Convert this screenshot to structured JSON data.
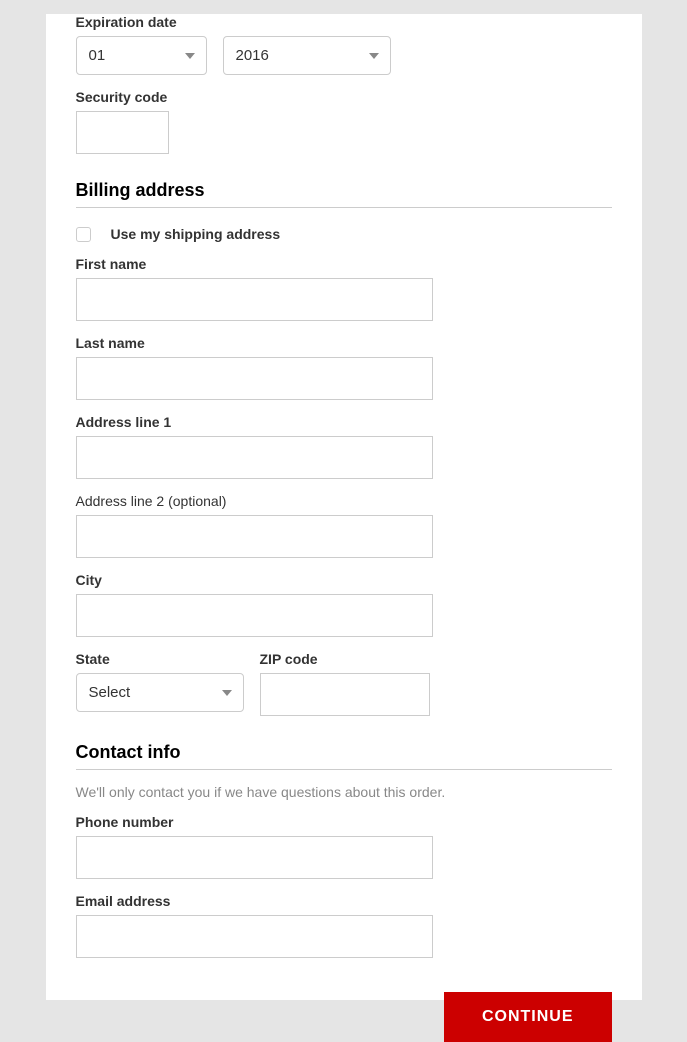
{
  "payment": {
    "expiration_label": "Expiration date",
    "month_value": "01",
    "year_value": "2016",
    "security_code_label": "Security code",
    "security_code_value": ""
  },
  "billing": {
    "heading": "Billing address",
    "use_shipping_label": "Use my shipping address",
    "first_name_label": "First name",
    "first_name_value": "",
    "last_name_label": "Last name",
    "last_name_value": "",
    "address1_label": "Address line 1",
    "address1_value": "",
    "address2_label": "Address line 2 (optional)",
    "address2_value": "",
    "city_label": "City",
    "city_value": "",
    "state_label": "State",
    "state_value": "Select",
    "zip_label": "ZIP code",
    "zip_value": ""
  },
  "contact": {
    "heading": "Contact info",
    "help_text": "We'll only contact you if we have questions about this order.",
    "phone_label": "Phone number",
    "phone_value": "",
    "email_label": "Email address",
    "email_value": ""
  },
  "actions": {
    "continue_label": "CONTINUE"
  }
}
